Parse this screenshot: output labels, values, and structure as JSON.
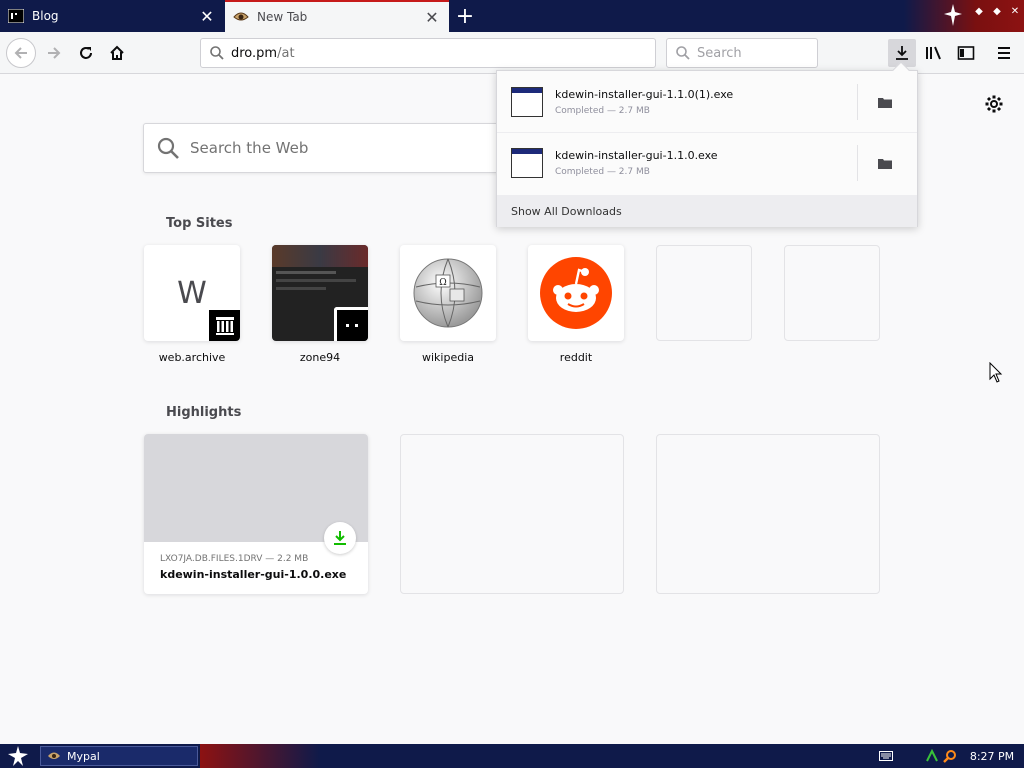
{
  "tabs": [
    {
      "title": "Blog",
      "active": false,
      "icon": "blog-favicon"
    },
    {
      "title": "New Tab",
      "active": true,
      "icon": "eye-favicon"
    }
  ],
  "navbar": {
    "url_host": "dro.pm",
    "url_path": "/at",
    "search_placeholder": "Search"
  },
  "newtab": {
    "search_placeholder": "Search the Web",
    "top_sites_title": "Top Sites",
    "top_sites": [
      {
        "label": "web.archive",
        "letter": "W",
        "icon": "archive-icon"
      },
      {
        "label": "zone94",
        "icon": "zone94-icon"
      },
      {
        "label": "wikipedia",
        "icon": "wikipedia-globe-icon",
        "glyph": "Ω"
      },
      {
        "label": "reddit",
        "icon": "reddit-alien-icon"
      },
      {
        "label": ""
      },
      {
        "label": ""
      }
    ],
    "highlights_title": "Highlights",
    "highlights": [
      {
        "source": "LXO7JA.DB.FILES.1DRV — 2.2 MB",
        "name": "kdewin-installer-gui-1.0.0.exe"
      }
    ]
  },
  "downloads": {
    "items": [
      {
        "filename": "kdewin-installer-gui-1.1.0(1).exe",
        "status": "Completed — 2.7 MB"
      },
      {
        "filename": "kdewin-installer-gui-1.1.0.exe",
        "status": "Completed — 2.7 MB"
      }
    ],
    "show_all": "Show All Downloads"
  },
  "taskbar": {
    "app_label": "Mypal",
    "clock": "8:27 PM"
  },
  "colors": {
    "accent": "#c61a1a",
    "titlebar": "#0f1a4a",
    "reddit": "#ff4500",
    "download_green": "#12bc00"
  }
}
